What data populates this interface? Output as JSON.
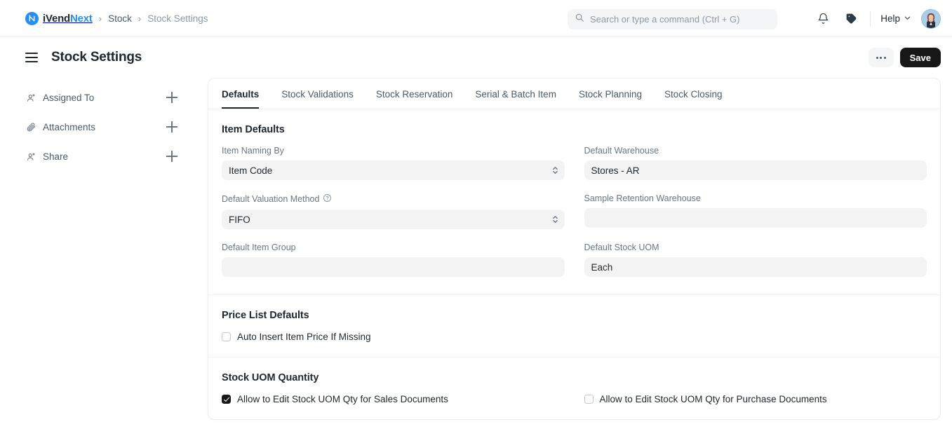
{
  "navbar": {
    "brand_first": "iVend",
    "brand_second": "Next",
    "brand_logo_icon": "ivendnext-logo-icon",
    "breadcrumbs": [
      {
        "label": "Stock",
        "current": false
      },
      {
        "label": "Stock Settings",
        "current": true
      }
    ],
    "separator": "›",
    "search": {
      "placeholder": "Search or type a command (Ctrl + G)",
      "value": "",
      "icon": "search-icon"
    },
    "notifications_icon": "bell-icon",
    "tags_icon": "tag-icon",
    "help_label": "Help",
    "help_chevron_icon": "chevron-down-icon",
    "avatar_icon": "user-avatar"
  },
  "page_head": {
    "menu_icon": "hamburger-icon",
    "title": "Stock Settings",
    "more_label": "…",
    "save_label": "Save"
  },
  "sidebar": {
    "items": [
      {
        "label": "Assigned To",
        "icon": "user-plus-icon",
        "action": "add-icon"
      },
      {
        "label": "Attachments",
        "icon": "paperclip-icon",
        "action": "add-icon"
      },
      {
        "label": "Share",
        "icon": "user-plus-icon",
        "action": "add-icon"
      }
    ]
  },
  "tabs": [
    {
      "label": "Defaults",
      "active": true
    },
    {
      "label": "Stock Validations",
      "active": false
    },
    {
      "label": "Stock Reservation",
      "active": false
    },
    {
      "label": "Serial & Batch Item",
      "active": false
    },
    {
      "label": "Stock Planning",
      "active": false
    },
    {
      "label": "Stock Closing",
      "active": false
    }
  ],
  "sections": {
    "item_defaults": {
      "title": "Item Defaults",
      "fields": {
        "item_naming_by": {
          "label": "Item Naming By",
          "value": "Item Code",
          "type": "select"
        },
        "default_warehouse": {
          "label": "Default Warehouse",
          "value": "Stores - AR",
          "type": "link"
        },
        "default_valuation_method": {
          "label": "Default Valuation Method",
          "value": "FIFO",
          "type": "select",
          "help_icon": "help-circle-icon"
        },
        "sample_retention_warehouse": {
          "label": "Sample Retention Warehouse",
          "value": "",
          "type": "link"
        },
        "default_item_group": {
          "label": "Default Item Group",
          "value": "",
          "type": "link"
        },
        "default_stock_uom": {
          "label": "Default Stock UOM",
          "value": "Each",
          "type": "link"
        }
      }
    },
    "price_list_defaults": {
      "title": "Price List Defaults",
      "checkboxes": [
        {
          "label": "Auto Insert Item Price If Missing",
          "checked": false
        }
      ]
    },
    "stock_uom_quantity": {
      "title": "Stock UOM Quantity",
      "checkboxes": [
        {
          "label": "Allow to Edit Stock UOM Qty for Sales Documents",
          "checked": true
        },
        {
          "label": "Allow to Edit Stock UOM Qty for Purchase Documents",
          "checked": false
        }
      ]
    }
  },
  "colors": {
    "brand_blue": "#2490ef",
    "text_dark": "#1f272e",
    "text_muted": "#6b7682",
    "input_bg": "#f3f3f3",
    "save_bg": "#171717"
  }
}
